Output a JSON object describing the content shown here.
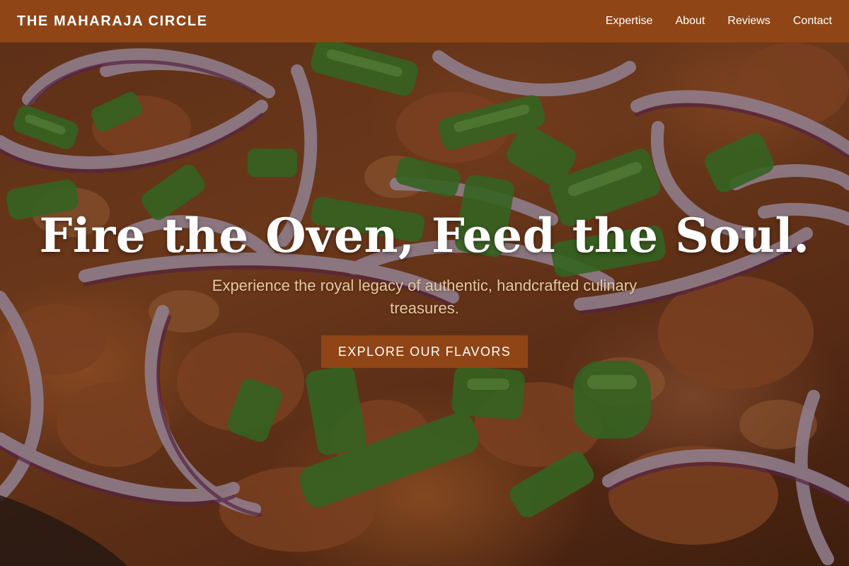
{
  "navbar": {
    "brand": "THE MAHARAJA CIRCLE",
    "links": [
      "Expertise",
      "About",
      "Reviews",
      "Contact"
    ]
  },
  "hero": {
    "title": "Fire the Oven, Feed the Soul.",
    "subtitle": "Experience the royal legacy of authentic, handcrafted culinary treasures.",
    "cta_label": "EXPLORE OUR FLAVORS",
    "background_image": "curry-with-red-onion-and-green-onion"
  },
  "colors": {
    "navbar_bg": "#8f4516",
    "button_bg": "#8f4516",
    "subtitle_text": "#e8c9a0",
    "title_text": "#ffffff"
  }
}
